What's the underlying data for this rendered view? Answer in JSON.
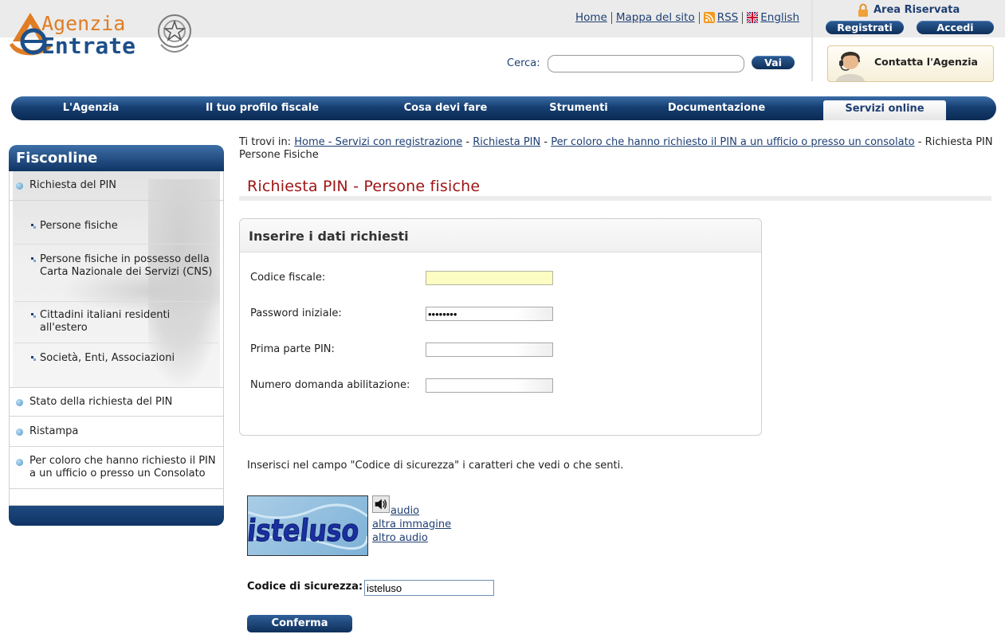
{
  "header": {
    "logo_line1": "Agenzia",
    "logo_line2": "Entrate",
    "toplinks": {
      "home": "Home",
      "sitemap": "Mappa del sito",
      "rss": "RSS",
      "english": "English"
    },
    "area_riservata": "Area Riservata",
    "registrati": "Registrati",
    "accedi": "Accedi",
    "search_label": "Cerca:",
    "search_value": "",
    "search_button": "Vai",
    "contatta": "Contatta l'Agenzia"
  },
  "nav": {
    "items": [
      "L'Agenzia",
      "Il tuo profilo fiscale",
      "Cosa devi fare",
      "Strumenti",
      "Documentazione",
      "Servizi online"
    ],
    "active": "Servizi online"
  },
  "sidebar": {
    "title": "Fisconline",
    "items": [
      "Richiesta del PIN",
      "Stato della richiesta del PIN",
      "Ristampa",
      "Per coloro che hanno richiesto il PIN a un ufficio o presso un Consolato"
    ],
    "subitems": [
      "Persone fisiche",
      "Persone fisiche in possesso della Carta Nazionale dei Servizi (CNS)",
      "Cittadini italiani residenti all'estero",
      "Società, Enti, Associazioni"
    ]
  },
  "breadcrumb": {
    "prefix": "Ti trovi in:",
    "links": [
      "Home - Servizi con registrazione",
      "Richiesta PIN",
      "Per coloro che hanno richiesto il PIN a un ufficio o presso un consolato"
    ],
    "separator": " - ",
    "current": "Richiesta PIN Persone Fisiche"
  },
  "page_title": "Richiesta PIN - Persone fisiche",
  "form": {
    "heading": "Inserire i dati richiesti",
    "fields": [
      {
        "label": "Codice fiscale:",
        "value": ""
      },
      {
        "label": "Password iniziale:",
        "value": "••••••••"
      },
      {
        "label": "Prima parte PIN:",
        "value": ""
      },
      {
        "label": "Numero domanda abilitazione:",
        "value": ""
      }
    ]
  },
  "captcha": {
    "hint": "Inserisci nel campo \"Codice di sicurezza\" i caratteri che vedi o che senti.",
    "image_text": "isteluso",
    "audio": "audio",
    "altra_immagine": "altra immagine",
    "altro_audio": "altro audio",
    "code_label": "Codice di sicurezza:",
    "code_value": "isteluso",
    "submit": "Conferma"
  },
  "colors": {
    "brand_blue": "#0f3465",
    "title_red": "#a01414",
    "logo_orange": "#e07d24",
    "input_highlight": "#fbfdc2"
  }
}
